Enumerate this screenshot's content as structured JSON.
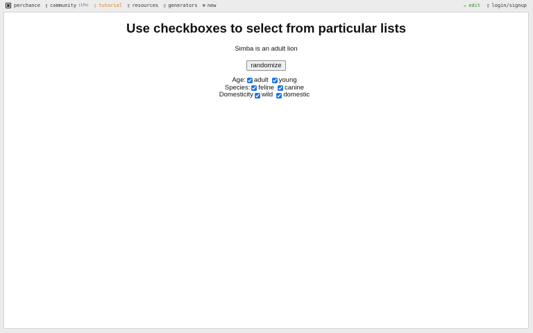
{
  "topbar": {
    "left": [
      {
        "id": "perchance",
        "label": "perchance",
        "icon": "dice-icon"
      },
      {
        "id": "community",
        "label": "community",
        "badge": "(17h)",
        "icon": "chat-icon"
      },
      {
        "id": "tutorial",
        "label": "tutorial",
        "icon": "book-icon",
        "color": "#d9821e"
      },
      {
        "id": "resources",
        "label": "resources",
        "icon": "box-icon"
      },
      {
        "id": "generators",
        "label": "generators",
        "icon": "grid-icon"
      },
      {
        "id": "new",
        "label": "new",
        "icon": "plus-circle-icon"
      }
    ],
    "right": [
      {
        "id": "edit",
        "label": "edit",
        "icon": "pencil-icon",
        "color": "#2e8b2e"
      },
      {
        "id": "login",
        "label": "login/signup",
        "icon": "user-icon"
      }
    ]
  },
  "main": {
    "title": "Use checkboxes to select from particular lists",
    "output": "Simba is an adult lion",
    "randomize_label": "randomize",
    "filters": [
      {
        "label": "Age:",
        "options": [
          {
            "label": "adult",
            "checked": true
          },
          {
            "label": "young",
            "checked": true
          }
        ]
      },
      {
        "label": "Species:",
        "options": [
          {
            "label": "feline",
            "checked": true
          },
          {
            "label": "canine",
            "checked": true
          }
        ]
      },
      {
        "label": "Domesticity",
        "options": [
          {
            "label": "wild",
            "checked": true
          },
          {
            "label": "domestic",
            "checked": true
          }
        ]
      }
    ]
  },
  "colors": {
    "background": "#ececec",
    "panel": "#ffffff",
    "tutorial": "#d9821e",
    "edit": "#2e8b2e",
    "checkbox": "#1a73e8"
  }
}
